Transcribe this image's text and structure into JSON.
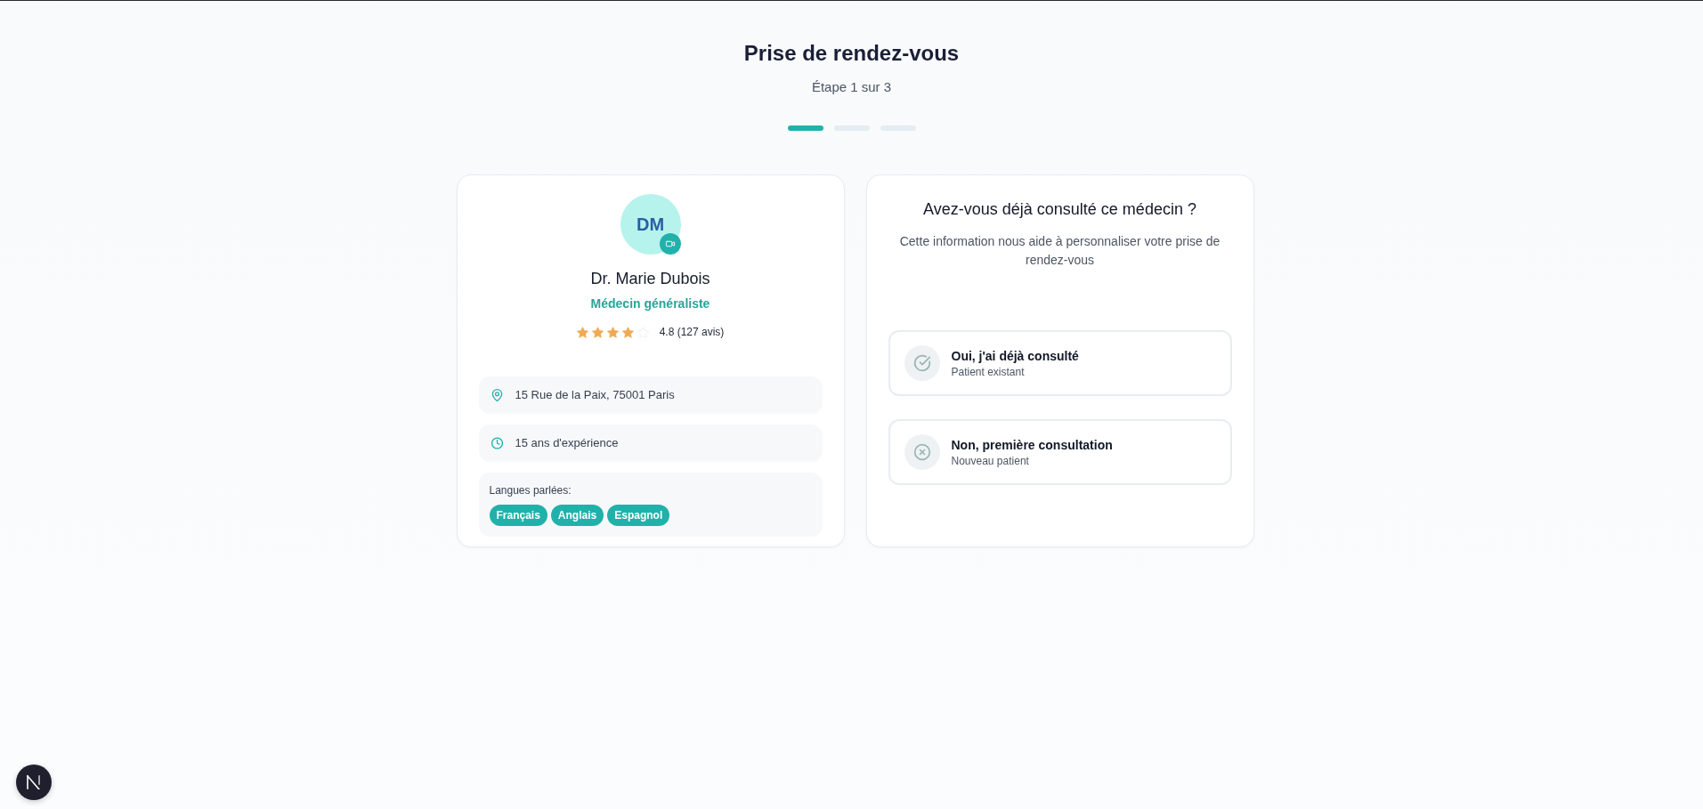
{
  "header": {
    "title": "Prise de rendez-vous",
    "subtitle": "Étape 1 sur 3",
    "steps": [
      {
        "active": true
      },
      {
        "active": false
      },
      {
        "active": false
      }
    ]
  },
  "doctor": {
    "initials": "DM",
    "video_available": true,
    "name": "Dr. Marie Dubois",
    "specialty": "Médecin généraliste",
    "rating": {
      "stars": 4,
      "text": "4.8 (127 avis)"
    },
    "info": [
      {
        "kind": "location",
        "text": "15 Rue de la Paix, 75001 Paris"
      },
      {
        "kind": "experience",
        "text": "15 ans d'expérience"
      }
    ],
    "languages": {
      "label": "Langues parlées:",
      "items": [
        "Français",
        "Anglais",
        "Espagnol"
      ]
    }
  },
  "question": {
    "title": "Avez-vous déjà consulté ce médecin ?",
    "description": "Cette information nous aide à personnaliser votre prise de rendez-vous",
    "options": [
      {
        "kind": "yes",
        "title": "Oui, j'ai déjà consulté",
        "subtitle": "Patient existant",
        "selected": false
      },
      {
        "kind": "no",
        "title": "Non, première consultation",
        "subtitle": "Nouveau patient",
        "selected": false
      }
    ]
  }
}
